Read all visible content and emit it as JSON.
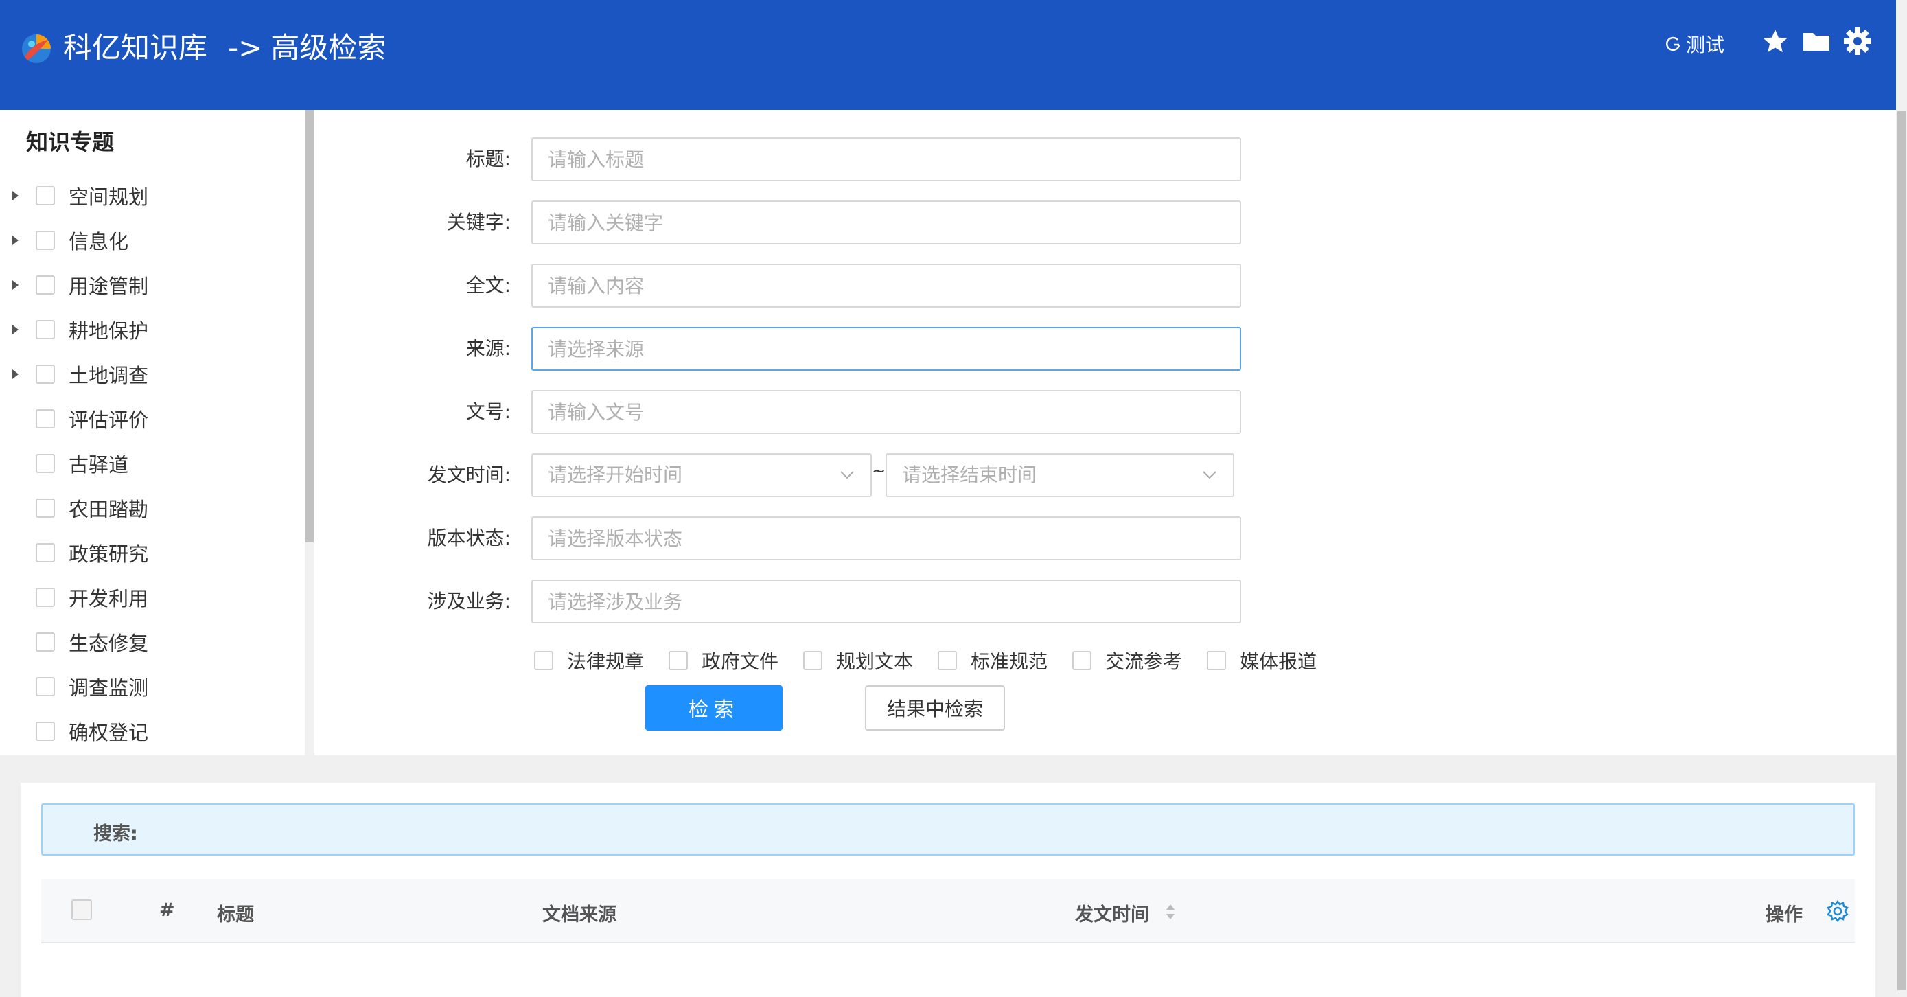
{
  "header": {
    "app_name": "科亿知识库",
    "arrow": "->",
    "page_name": "高级检索",
    "user_name": "测试",
    "icons": [
      "refresh-icon",
      "star-icon",
      "folder-icon",
      "gear-icon"
    ],
    "colors": {
      "background": "#1b55c2",
      "text": "#ffffff"
    }
  },
  "sidebar": {
    "title": "知识专题",
    "items": [
      {
        "label": "空间规划",
        "expandable": true
      },
      {
        "label": "信息化",
        "expandable": true
      },
      {
        "label": "用途管制",
        "expandable": true
      },
      {
        "label": "耕地保护",
        "expandable": true
      },
      {
        "label": "土地调查",
        "expandable": true
      },
      {
        "label": "评估评价",
        "expandable": false
      },
      {
        "label": "古驿道",
        "expandable": false
      },
      {
        "label": "农田踏勘",
        "expandable": false
      },
      {
        "label": "政策研究",
        "expandable": false
      },
      {
        "label": "开发利用",
        "expandable": false
      },
      {
        "label": "生态修复",
        "expandable": false
      },
      {
        "label": "调查监测",
        "expandable": false
      },
      {
        "label": "确权登记",
        "expandable": false
      }
    ]
  },
  "form": {
    "title": {
      "label": "标题:",
      "placeholder": "请输入标题",
      "value": ""
    },
    "keyword": {
      "label": "关键字:",
      "placeholder": "请输入关键字",
      "value": ""
    },
    "fulltext": {
      "label": "全文:",
      "placeholder": "请输入内容",
      "value": ""
    },
    "source": {
      "label": "来源:",
      "placeholder": "请选择来源",
      "value": ""
    },
    "docno": {
      "label": "文号:",
      "placeholder": "请输入文号",
      "value": ""
    },
    "date": {
      "label": "发文时间:",
      "start_placeholder": "请选择开始时间",
      "end_placeholder": "请选择结束时间",
      "separator": "~"
    },
    "version": {
      "label": "版本状态:",
      "placeholder": "请选择版本状态",
      "value": ""
    },
    "business": {
      "label": "涉及业务:",
      "placeholder": "请选择涉及业务",
      "value": ""
    },
    "types": [
      "法律规章",
      "政府文件",
      "规划文本",
      "标准规范",
      "交流参考",
      "媒体报道"
    ],
    "search_button": "检索",
    "search_in_results_button": "结果中检索",
    "accent_color": "#1e90ff"
  },
  "results": {
    "search_label": "搜索:",
    "columns": {
      "index": "#",
      "title": "标题",
      "source": "文档来源",
      "date": "发文时间",
      "actions": "操作"
    },
    "rows": []
  }
}
